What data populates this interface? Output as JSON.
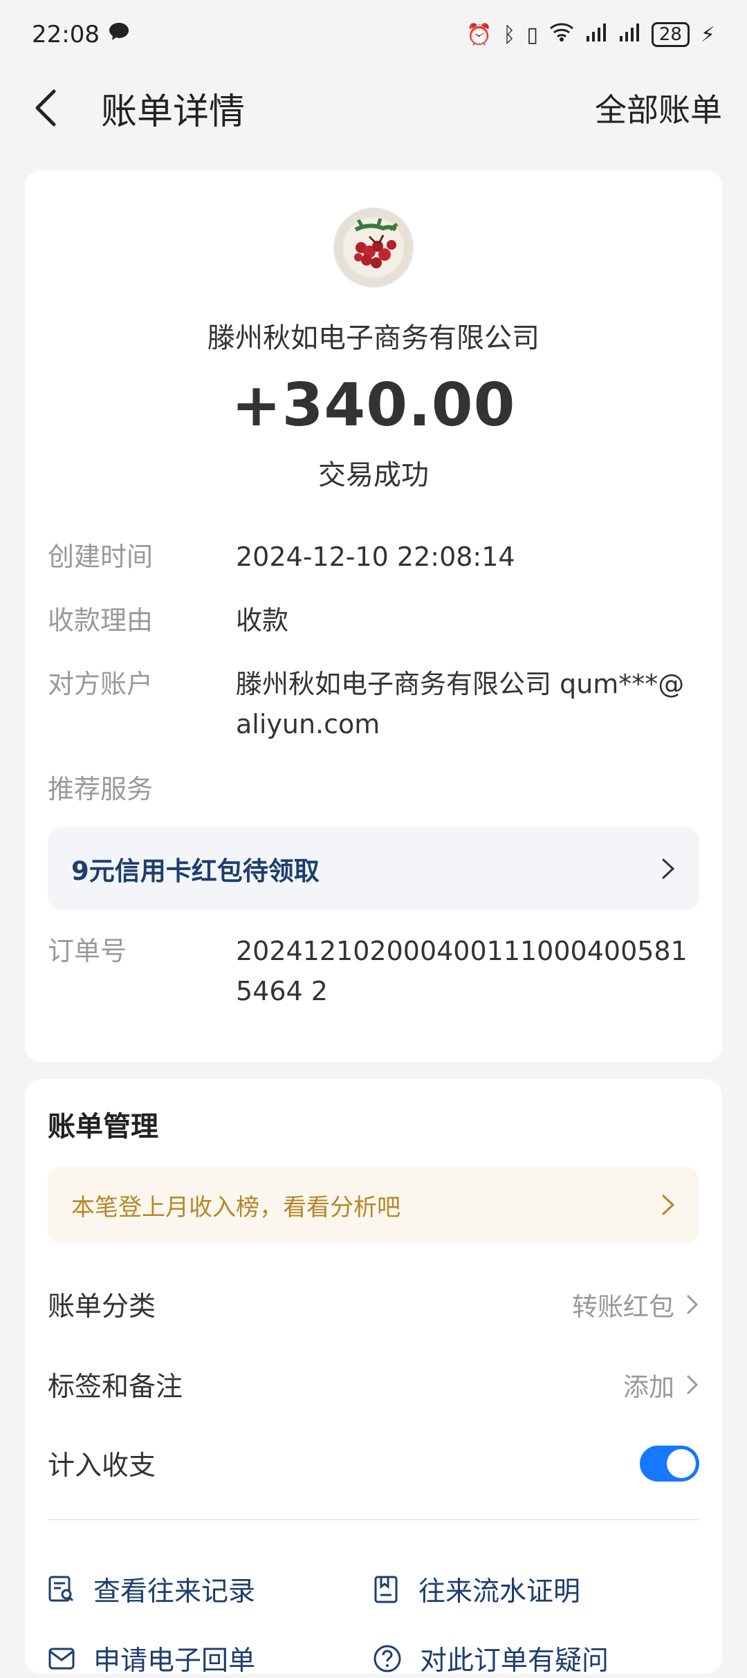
{
  "status_bar": {
    "time": "22:08",
    "battery": "28"
  },
  "header": {
    "title": "账单详情",
    "all_bills": "全部账单"
  },
  "summary": {
    "merchant": "滕州秋如电子商务有限公司",
    "amount": "+340.00",
    "status": "交易成功"
  },
  "details": [
    {
      "label": "创建时间",
      "value": "2024-12-10 22:08:14"
    },
    {
      "label": "收款理由",
      "value": "收款"
    },
    {
      "label": "对方账户",
      "value": "滕州秋如电子商务有限公司 qum***@aliyun.com"
    },
    {
      "label": "推荐服务",
      "value": ""
    },
    {
      "label": "订单号",
      "value": "2024121020004001110004005815464 2"
    }
  ],
  "promo": {
    "text": "9元信用卡红包待领取"
  },
  "management": {
    "title": "账单管理",
    "promo_text": "本笔登上月收入榜，看看分析吧",
    "category_label": "账单分类",
    "category_value": "转账红包",
    "tags_label": "标签和备注",
    "tags_value": "添加",
    "count_label": "计入收支",
    "count_enabled": true
  },
  "actions": [
    {
      "label": "查看往来记录",
      "icon": "search-record-icon"
    },
    {
      "label": "往来流水证明",
      "icon": "document-icon"
    },
    {
      "label": "申请电子回单",
      "icon": "mail-icon"
    },
    {
      "label": "对此订单有疑问",
      "icon": "question-icon"
    }
  ]
}
